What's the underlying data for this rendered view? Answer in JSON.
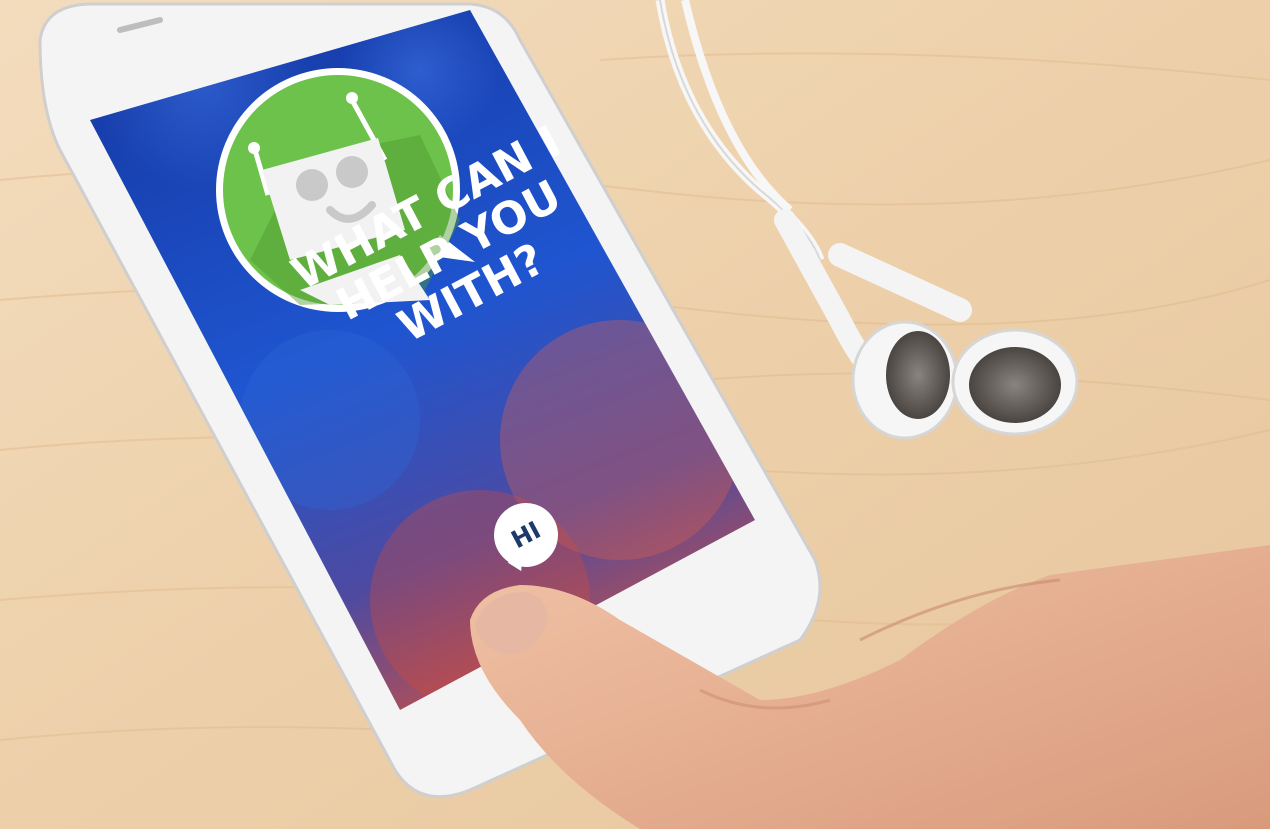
{
  "screen": {
    "prompt_lines": [
      "WHAT CAN I",
      "HELP YOU",
      "WITH?"
    ],
    "reply_bubble": "HI"
  },
  "colors": {
    "screen_top": "#1a3fa8",
    "screen_bottom": "#d9503e",
    "avatar_bg": "#6cc24a",
    "table": "#f0d5b0"
  },
  "icons": [
    "robot-avatar-icon",
    "speech-bubble-icon"
  ]
}
